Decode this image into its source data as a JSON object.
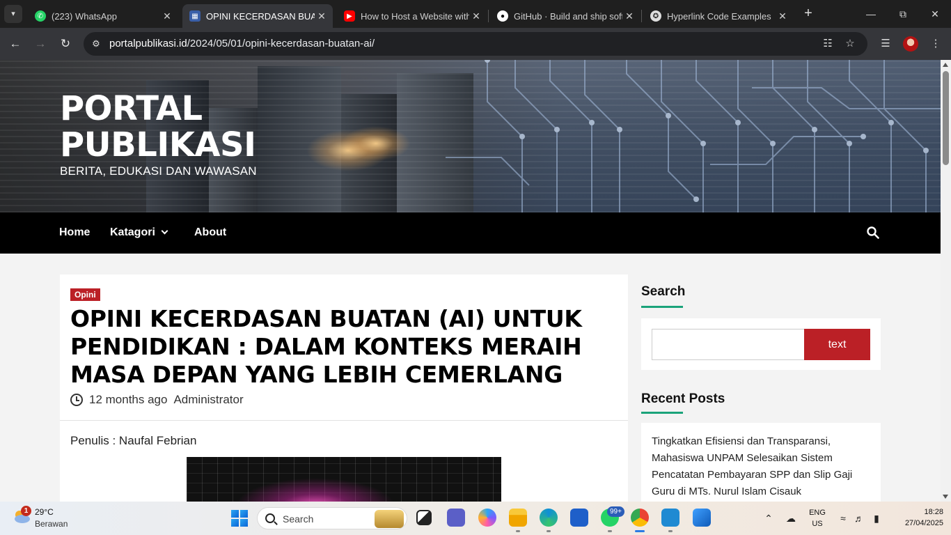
{
  "browser": {
    "tabs": [
      {
        "title": "(223) WhatsApp",
        "icon": "whatsapp-icon"
      },
      {
        "title": "OPINI KECERDASAN BUATAN",
        "icon": "site-favicon",
        "active": true
      },
      {
        "title": "How to Host a Website with",
        "icon": "youtube-icon"
      },
      {
        "title": "GitHub · Build and ship softw",
        "icon": "github-icon"
      },
      {
        "title": "Hyperlink Code Examples",
        "icon": "openai-icon"
      }
    ],
    "url_host": "portalpublikasi.id",
    "url_path": "/2024/05/01/opini-kecerdasan-buatan-ai/"
  },
  "site": {
    "title": "PORTAL PUBLIKASI",
    "tagline": "BERITA, EDUKASI DAN WAWASAN",
    "nav": {
      "home": "Home",
      "category": "Katagori",
      "about": "About"
    }
  },
  "article": {
    "category": "Opini",
    "title": "OPINI KECERDASAN BUATAN (AI) UNTUK PENDIDIKAN : DALAM KONTEKS MERAIH MASA DEPAN YANG LEBIH CEMERLANG",
    "time": "12 months ago",
    "author": "Administrator",
    "writer": "Penulis : Naufal Febrian"
  },
  "sidebar": {
    "search_heading": "Search",
    "search_button": "text",
    "recent_heading": "Recent Posts",
    "recent_posts": [
      "Tingkatkan Efisiensi dan Transparansi, Mahasiswa UNPAM Selesaikan Sistem Pencatatan Pembayaran SPP dan Slip Gaji Guru di MTs. Nurul Islam Cisauk"
    ]
  },
  "taskbar": {
    "weather_badge": "1",
    "temperature": "29°C",
    "weather": "Berawan",
    "search_label": "Search",
    "whatsapp_badge": "99+",
    "lang": "ENG",
    "region": "US",
    "time": "18:28",
    "date": "27/04/2025"
  },
  "colors": {
    "accent_red": "#bb2026",
    "underline_green": "#1aa37a",
    "nav_bg": "#000000"
  }
}
